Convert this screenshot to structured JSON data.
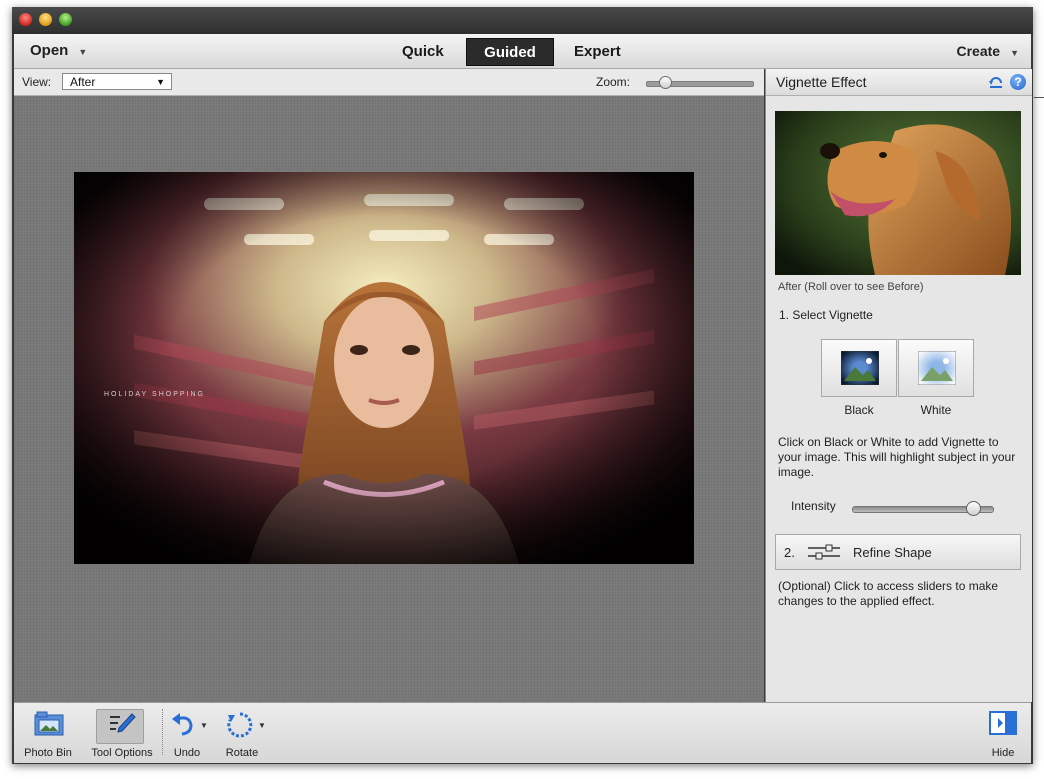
{
  "menubar": {
    "open_label": "Open",
    "modes": [
      "Quick",
      "Guided",
      "Expert"
    ],
    "active_mode": "Guided",
    "create_label": "Create"
  },
  "viewbar": {
    "view_label": "View:",
    "view_value": "After",
    "zoom_label": "Zoom:"
  },
  "canvas": {
    "photo_caption": "HOLIDAY SHOPPING"
  },
  "panel": {
    "title": "Vignette Effect",
    "preview_caption": "After (Roll over to see Before)",
    "step1_label": "1. Select Vignette",
    "options": {
      "black": "Black",
      "white": "White"
    },
    "description": "Click on Black or White to add Vignette to your image. This will highlight subject in your image.",
    "intensity_label": "Intensity",
    "intensity_value": 0.9,
    "step2_number": "2.",
    "step2_label": "Refine Shape",
    "step2_description": "(Optional) Click to access sliders to make changes to the applied effect."
  },
  "bottombar": {
    "photo_bin": "Photo Bin",
    "tool_options": "Tool Options",
    "undo": "Undo",
    "rotate": "Rotate",
    "hide": "Hide"
  },
  "colors": {
    "active_mode_bg": "#2b2b2b",
    "canvas_bg": "#7b7b7b",
    "panel_bg": "#e6e6e6",
    "help_icon": "#1f62c8"
  }
}
